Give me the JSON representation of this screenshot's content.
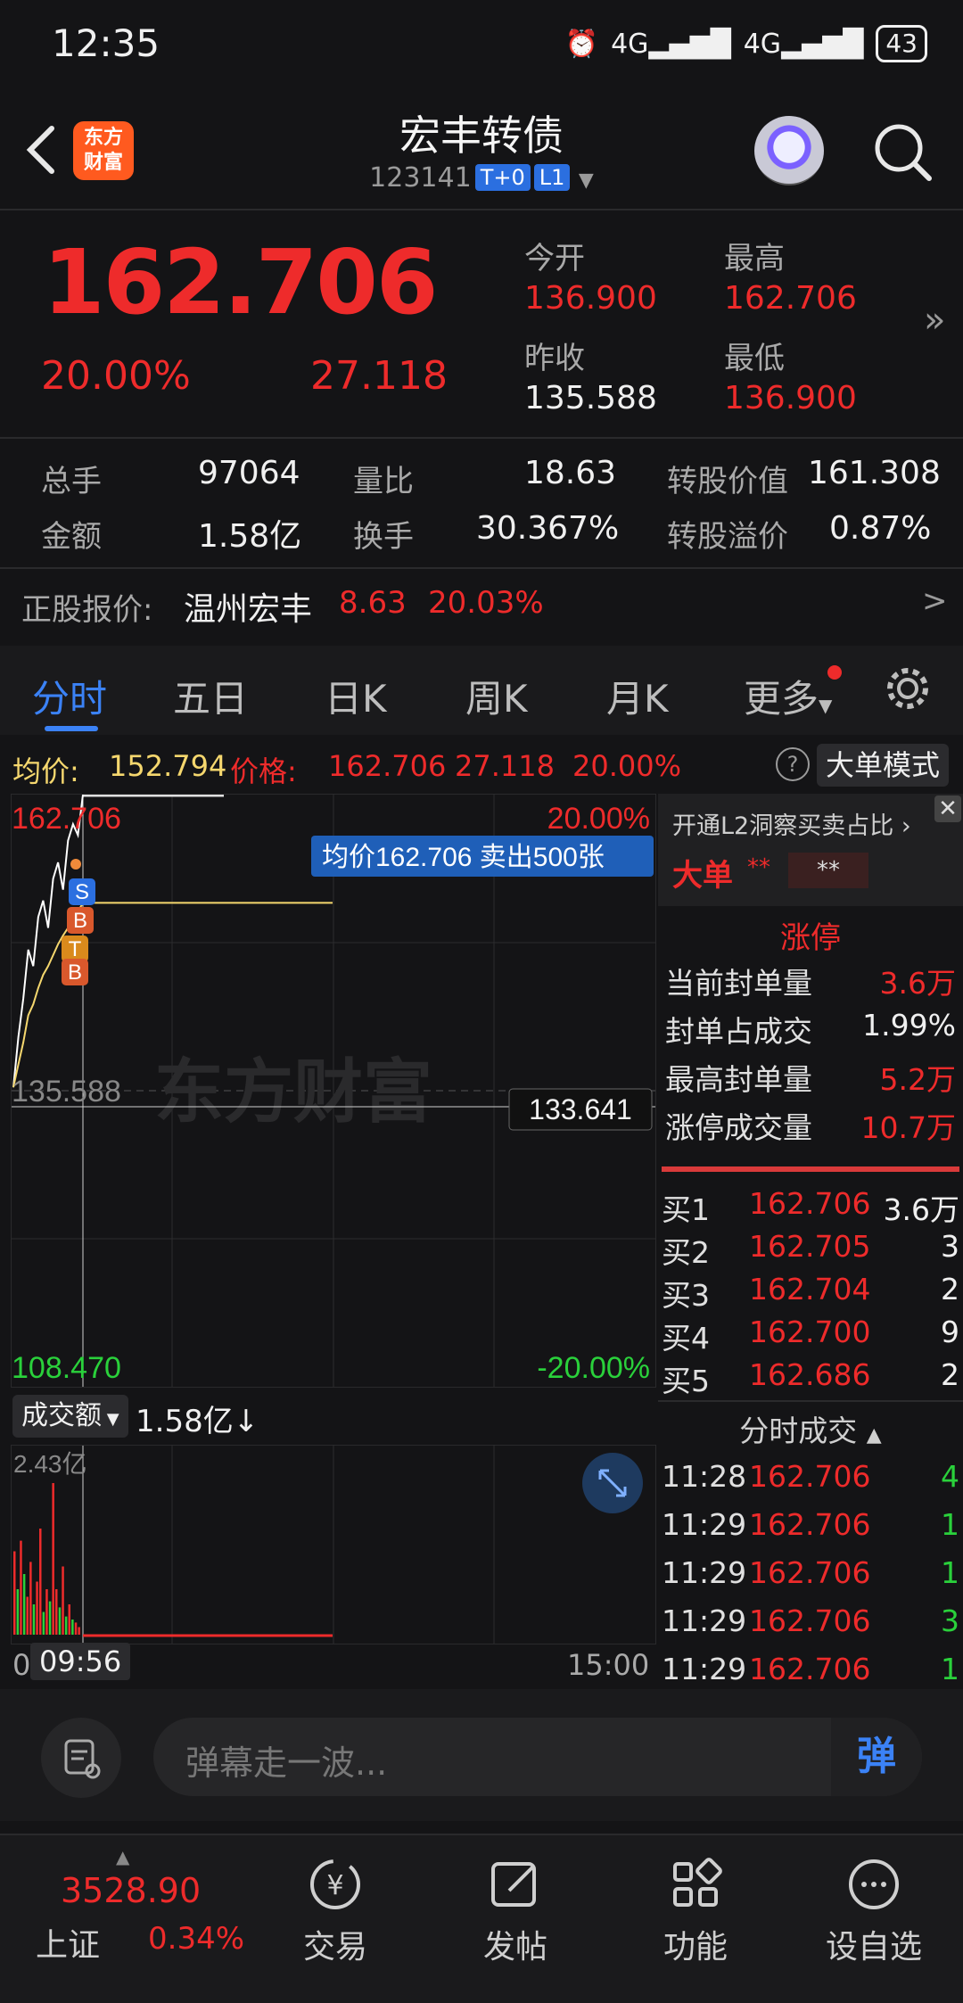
{
  "status": {
    "time": "12:35",
    "signal1": "4G",
    "signal2": "4G",
    "battery": "43"
  },
  "header": {
    "title": "宏丰转债",
    "code": "123141",
    "tag1": "T+0",
    "tag2": "L1",
    "logo_text_1": "东方",
    "logo_text_2": "财富"
  },
  "quote": {
    "price": "162.706",
    "pct": "20.00%",
    "change": "27.118",
    "open_label": "今开",
    "open": "136.900",
    "high_label": "最高",
    "high": "162.706",
    "prev_label": "昨收",
    "prev": "135.588",
    "low_label": "最低",
    "low": "136.900"
  },
  "stats": {
    "vol_label": "总手",
    "vol": "97064",
    "ratio_label": "量比",
    "ratio": "18.63",
    "conv_value_label": "转股价值",
    "conv_value": "161.308",
    "amount_label": "金额",
    "amount": "1.58亿",
    "turnover_label": "换手",
    "turnover": "30.367%",
    "premium_label": "转股溢价",
    "premium": "0.87%"
  },
  "stock": {
    "label": "正股报价:",
    "name": "温州宏丰",
    "price": "8.63",
    "pct": "20.03%",
    "arrow": ">"
  },
  "tabs": [
    "分时",
    "五日",
    "日K",
    "周K",
    "月K",
    "更多"
  ],
  "info_bar": {
    "avg_label": "均价:",
    "avg": "152.794",
    "price_label": "价格:",
    "price": "162.706",
    "chg": "27.118",
    "pct": "20.00%",
    "mode_btn": "大单模式"
  },
  "chart": {
    "top_left": "162.706",
    "top_right": "20.00%",
    "mid_left": "135.588",
    "bottom_left": "108.470",
    "bottom_right": "-20.00%",
    "cursor_value": "133.641",
    "tooltip": "均价162.706  卖出500张",
    "watermark": "东方财富",
    "markers": [
      "S",
      "B",
      "T",
      "B"
    ]
  },
  "chart_data": {
    "type": "line",
    "title": "",
    "ylim": [
      108.47,
      162.706
    ],
    "prev_close": 135.588,
    "x_start": "09:30",
    "x_end": "15:00",
    "series": [
      {
        "values": [
          135.9,
          140.5,
          144.0,
          148.5,
          147.0,
          151.5,
          153.0,
          150.5,
          155.0,
          156.5,
          154.0,
          158.5,
          160.0,
          159.0,
          162.706
        ]
      },
      {
        "values": [
          135.9,
          138.0,
          140.0,
          142.5,
          143.5,
          145.0,
          146.2,
          147.0,
          148.0,
          149.0,
          149.8,
          150.5,
          151.2,
          152.0,
          152.794
        ]
      }
    ]
  },
  "volume": {
    "label": "成交额",
    "value": "1.58亿",
    "arrow": "↓",
    "scale_top": "2.43亿",
    "x_left": "0",
    "x_cursor": "09:56",
    "x_right": "15:00",
    "bars": [
      0.55,
      0.3,
      0.62,
      0.4,
      0.25,
      0.48,
      0.2,
      0.35,
      0.7,
      0.15,
      0.3,
      0.22,
      1.0,
      0.3,
      0.18,
      0.45,
      0.12,
      0.2,
      0.1,
      0.08,
      0.05
    ],
    "colors": [
      "r",
      "g",
      "r",
      "g",
      "r",
      "r",
      "g",
      "r",
      "r",
      "g",
      "r",
      "g",
      "r",
      "r",
      "g",
      "r",
      "g",
      "r",
      "g",
      "r",
      "r"
    ]
  },
  "right_panel": {
    "l2_link": "开通L2洞察买卖占比",
    "big_label": "大单",
    "big_val1": "**",
    "big_val2": "**",
    "limit_label": "涨停",
    "rows": [
      {
        "label": "当前封单量",
        "value": "3.6万"
      },
      {
        "label": "封单占成交",
        "value": "1.99%"
      },
      {
        "label": "最高封单量",
        "value": "5.2万"
      },
      {
        "label": "涨停成交量",
        "value": "10.7万"
      }
    ],
    "bids": [
      {
        "label": "买1",
        "price": "162.706",
        "qty": "3.6万"
      },
      {
        "label": "买2",
        "price": "162.705",
        "qty": "3"
      },
      {
        "label": "买3",
        "price": "162.704",
        "qty": "2"
      },
      {
        "label": "买4",
        "price": "162.700",
        "qty": "9"
      },
      {
        "label": "买5",
        "price": "162.686",
        "qty": "2"
      }
    ],
    "ticks_title": "分时成交",
    "ticks": [
      {
        "time": "11:28",
        "price": "162.706",
        "qty": "4"
      },
      {
        "time": "11:29",
        "price": "162.706",
        "qty": "1"
      },
      {
        "time": "11:29",
        "price": "162.706",
        "qty": "1"
      },
      {
        "time": "11:29",
        "price": "162.706",
        "qty": "3"
      },
      {
        "time": "11:29",
        "price": "162.706",
        "qty": "1"
      }
    ]
  },
  "comment": {
    "placeholder": "弹幕走一波...",
    "send": "弹"
  },
  "nav": {
    "index_value": "3528.90",
    "index_name": "上证",
    "index_pct": "0.34%",
    "items": [
      "交易",
      "发帖",
      "功能",
      "设自选"
    ]
  },
  "colors": {
    "up": "#ee2b2b",
    "down": "#2ad13b",
    "accent": "#3b82f6",
    "avg": "#f5d76e"
  }
}
